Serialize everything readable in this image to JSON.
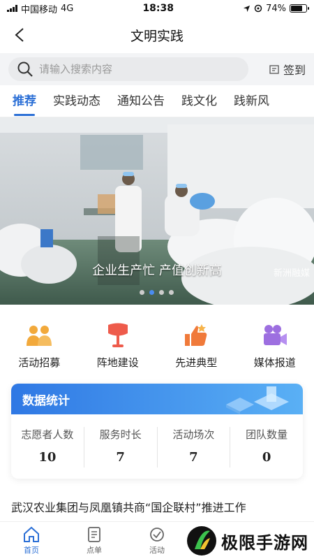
{
  "status": {
    "carrier": "中国移动",
    "network": "4G",
    "time": "18:38",
    "battery": "74%",
    "battery_level": 0.74
  },
  "nav": {
    "title": "文明实践"
  },
  "search": {
    "placeholder": "请输入搜索内容",
    "signin_label": "签到"
  },
  "tabs": [
    {
      "label": "推荐",
      "active": true
    },
    {
      "label": "实践动态"
    },
    {
      "label": "通知公告"
    },
    {
      "label": "践文化"
    },
    {
      "label": "践新风"
    }
  ],
  "banner": {
    "caption": "企业生产忙 产值创新高",
    "watermark": "新洲融媒",
    "slide_count": 4,
    "current_slide": 2
  },
  "quick_links": [
    {
      "label": "活动招募",
      "icon": "people-icon",
      "color": "#f2a93b"
    },
    {
      "label": "阵地建设",
      "icon": "flag-icon",
      "color": "#ee5b4b"
    },
    {
      "label": "先进典型",
      "icon": "thumbs-up-icon",
      "color": "#f07a3a"
    },
    {
      "label": "媒体报道",
      "icon": "video-camera-icon",
      "color": "#9d6fe0"
    }
  ],
  "stats": {
    "title": "数据统计",
    "items": [
      {
        "label": "志愿者人数",
        "value": "10"
      },
      {
        "label": "服务时长",
        "value": "7"
      },
      {
        "label": "活动场次",
        "value": "7"
      },
      {
        "label": "团队数量",
        "value": "0"
      }
    ]
  },
  "news": {
    "headline": "武汉农业集团与凤凰镇共商“国企联村”推进工作"
  },
  "tabbar": {
    "items": [
      {
        "label": "首页",
        "icon": "home-icon",
        "active": true
      },
      {
        "label": "点单",
        "icon": "document-icon"
      },
      {
        "label": "活动",
        "icon": "check-circle-icon"
      }
    ],
    "brand_text": "极限手游网"
  },
  "colors": {
    "accent": "#2b6fd6"
  }
}
